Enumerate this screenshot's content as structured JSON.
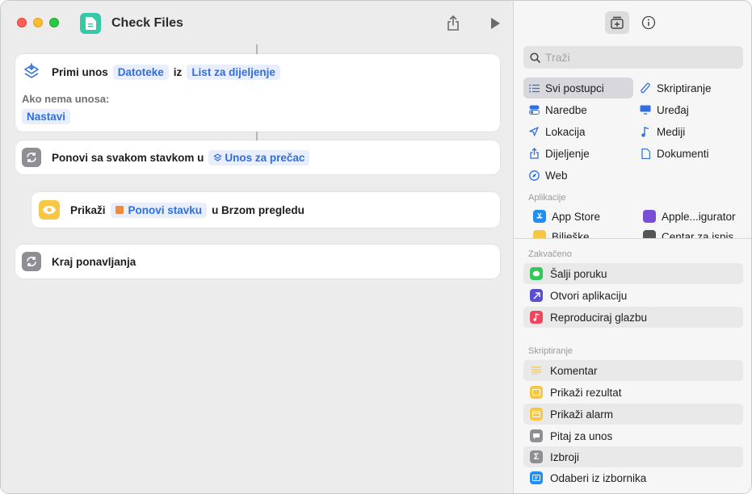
{
  "window": {
    "title": "Check Files"
  },
  "editor": {
    "actions": [
      {
        "label": "Primi unos",
        "param1": "Datoteke",
        "mid": "iz",
        "param2": "List za dijeljenje",
        "fallback_label": "Ako nema unosa:",
        "fallback_value": "Nastavi"
      },
      {
        "label": "Ponovi sa svakom stavkom u",
        "param": "Unos za prečac"
      },
      {
        "label": "Prikaži",
        "param": "Ponovi stavku",
        "suffix": "u Brzom pregledu"
      },
      {
        "label": "Kraj ponavljanja"
      }
    ]
  },
  "sidebar": {
    "search_placeholder": "Traži",
    "categories_left": [
      "Svi postupci",
      "Naredbe",
      "Lokacija",
      "Dijeljenje",
      "Web"
    ],
    "categories_right": [
      "Skriptiranje",
      "Uređaj",
      "Mediji",
      "Dokumenti"
    ],
    "apps_label": "Aplikacije",
    "apps": [
      "App Store",
      "Apple...igurator",
      "Bilješke",
      "Centar za ispis"
    ],
    "pinned_label": "Zakvačeno",
    "pinned": [
      "Šalji poruku",
      "Otvori aplikaciju",
      "Reproduciraj glazbu"
    ],
    "scripting_label": "Skriptiranje",
    "scripting": [
      "Komentar",
      "Prikaži rezultat",
      "Prikaži alarm",
      "Pitaj za unos",
      "Izbroji",
      "Odaberi iz izbornika"
    ]
  },
  "colors": {
    "accent": "#2f6fe0",
    "pill_bg": "#e8eefb",
    "app_icon": "#35c9a8",
    "repeat_icon": "#8e8e93",
    "quicklook_icon": "#f7c744"
  }
}
